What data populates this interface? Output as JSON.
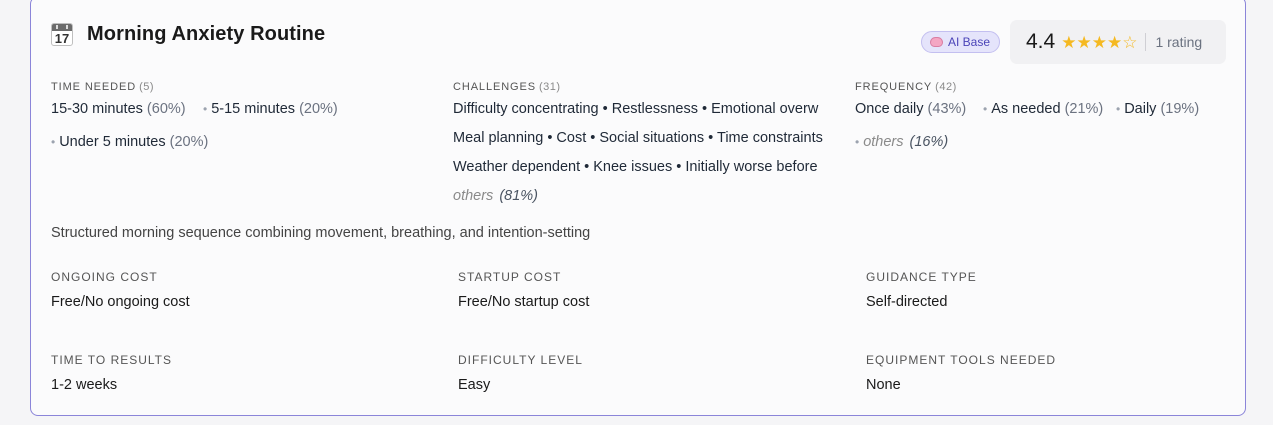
{
  "card": {
    "title": "Morning Anxiety Routine",
    "icon": "calendar-icon",
    "icon_day": "17",
    "badge": {
      "icon": "brain-icon",
      "label": "AI Base"
    },
    "rating": {
      "value": "4.4",
      "stars": 4.4,
      "count_label": "1 rating",
      "star_color": "#f5b921"
    },
    "accent_border": "#8b85d9",
    "time_needed": {
      "label": "TIME NEEDED",
      "count": "(5)",
      "items": [
        {
          "text": "15-30 minutes",
          "pct": "(60%)"
        },
        {
          "text": "5-15 minutes",
          "pct": "(20%)"
        },
        {
          "text": "Under 5 minutes",
          "pct": "(20%)"
        }
      ]
    },
    "challenges": {
      "label": "CHALLENGES",
      "count": "(31)",
      "lines": [
        "Difficulty concentrating • Restlessness • Emotional overw",
        "Meal planning • Cost • Social situations • Time constraints",
        "Weather dependent • Knee issues • Initially worse before"
      ],
      "others_label": "others",
      "others_pct": "(81%)"
    },
    "frequency": {
      "label": "FREQUENCY",
      "count": "(42)",
      "items": [
        {
          "text": "Once daily",
          "pct": "(43%)"
        },
        {
          "text": "As needed",
          "pct": "(21%)"
        },
        {
          "text": "Daily",
          "pct": "(19%)"
        }
      ],
      "others_label": "others",
      "others_pct": "(16%)"
    },
    "description": "Structured morning sequence combining movement, breathing, and intention-setting",
    "meta": {
      "ongoing_cost": {
        "label": "ONGOING COST",
        "value": "Free/No ongoing cost"
      },
      "startup_cost": {
        "label": "STARTUP COST",
        "value": "Free/No startup cost"
      },
      "guidance_type": {
        "label": "GUIDANCE TYPE",
        "value": "Self-directed"
      },
      "time_to_results": {
        "label": "TIME TO RESULTS",
        "value": "1-2 weeks"
      },
      "difficulty_level": {
        "label": "DIFFICULTY LEVEL",
        "value": "Easy"
      },
      "equipment": {
        "label": "EQUIPMENT TOOLS NEEDED",
        "value": "None"
      }
    }
  }
}
